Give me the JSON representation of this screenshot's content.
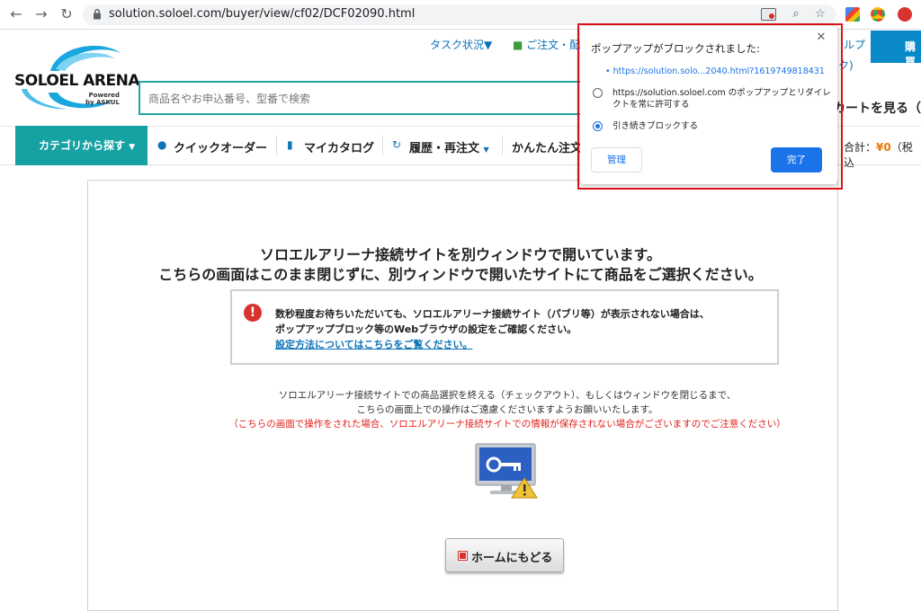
{
  "browser": {
    "url": "solution.soloel.com/buyer/view/cf02/DCF02090.html"
  },
  "header": {
    "logo_text": "SOLOEL ARENA",
    "logo_sub1": "Powered",
    "logo_sub2": "by ASKUL",
    "task_link": "タスク状況▼",
    "order_link": "ご注文・配",
    "help_link": "ルプ",
    "help_sub": "ク)",
    "buy_label": "購買",
    "search_placeholder": "商品名やお申込番号、型番で検索",
    "cart_label": "カートを見る（",
    "nav": {
      "category": "カテゴリから探す",
      "quick_order": "クイックオーダー",
      "my_catalog": "マイカタログ",
      "history": "履歴・再注文",
      "easy_order": "かんたん注文",
      "total_label": "合計：",
      "total_value": "¥0",
      "total_tax": "（税込"
    }
  },
  "popup": {
    "title": "ポップアップがブロックされました:",
    "blocked_url": "https://solution.solo...2040.html?1619749818431",
    "option_allow_line1": "https://solution.soloel.com のポップアップとリダイレ",
    "option_allow_line2": "クトを常に許可する",
    "option_block": "引き続きブロックする",
    "manage_label": "管理",
    "done_label": "完了"
  },
  "content": {
    "heading1": "ソロエルアリーナ接続サイトを別ウィンドウで開いています。",
    "heading2": "こちらの画面はこのまま閉じずに、別ウィンドウで開いたサイトにて商品をご選択ください。",
    "notice_line1": "数秒程度お待ちいただいても、ソロエルアリーナ接続サイト（パブリ等）が表示されない場合は、",
    "notice_line2": "ポップアップブロック等のWebブラウザの設定をご確認ください。",
    "notice_link": "設定方法についてはこちらをご覧ください。",
    "info_line1": "ソロエルアリーナ接続サイトでの商品選択を終える（チェックアウト）、もしくはウィンドウを閉じるまで、",
    "info_line2": "こちらの画面上での操作はご遠慮くださいますようお願いいたします。",
    "caution": "（こちらの画面で操作をされた場合、ソロエルアリーナ接続サイトでの情報が保存されない場合がございますのでご注意ください）",
    "home_button": "ホームにもどる"
  },
  "colors": {
    "teal": "#16a1a3",
    "link_blue": "#0b73b8",
    "chrome_blue": "#1a73e8",
    "alert_red": "#e2141b"
  }
}
